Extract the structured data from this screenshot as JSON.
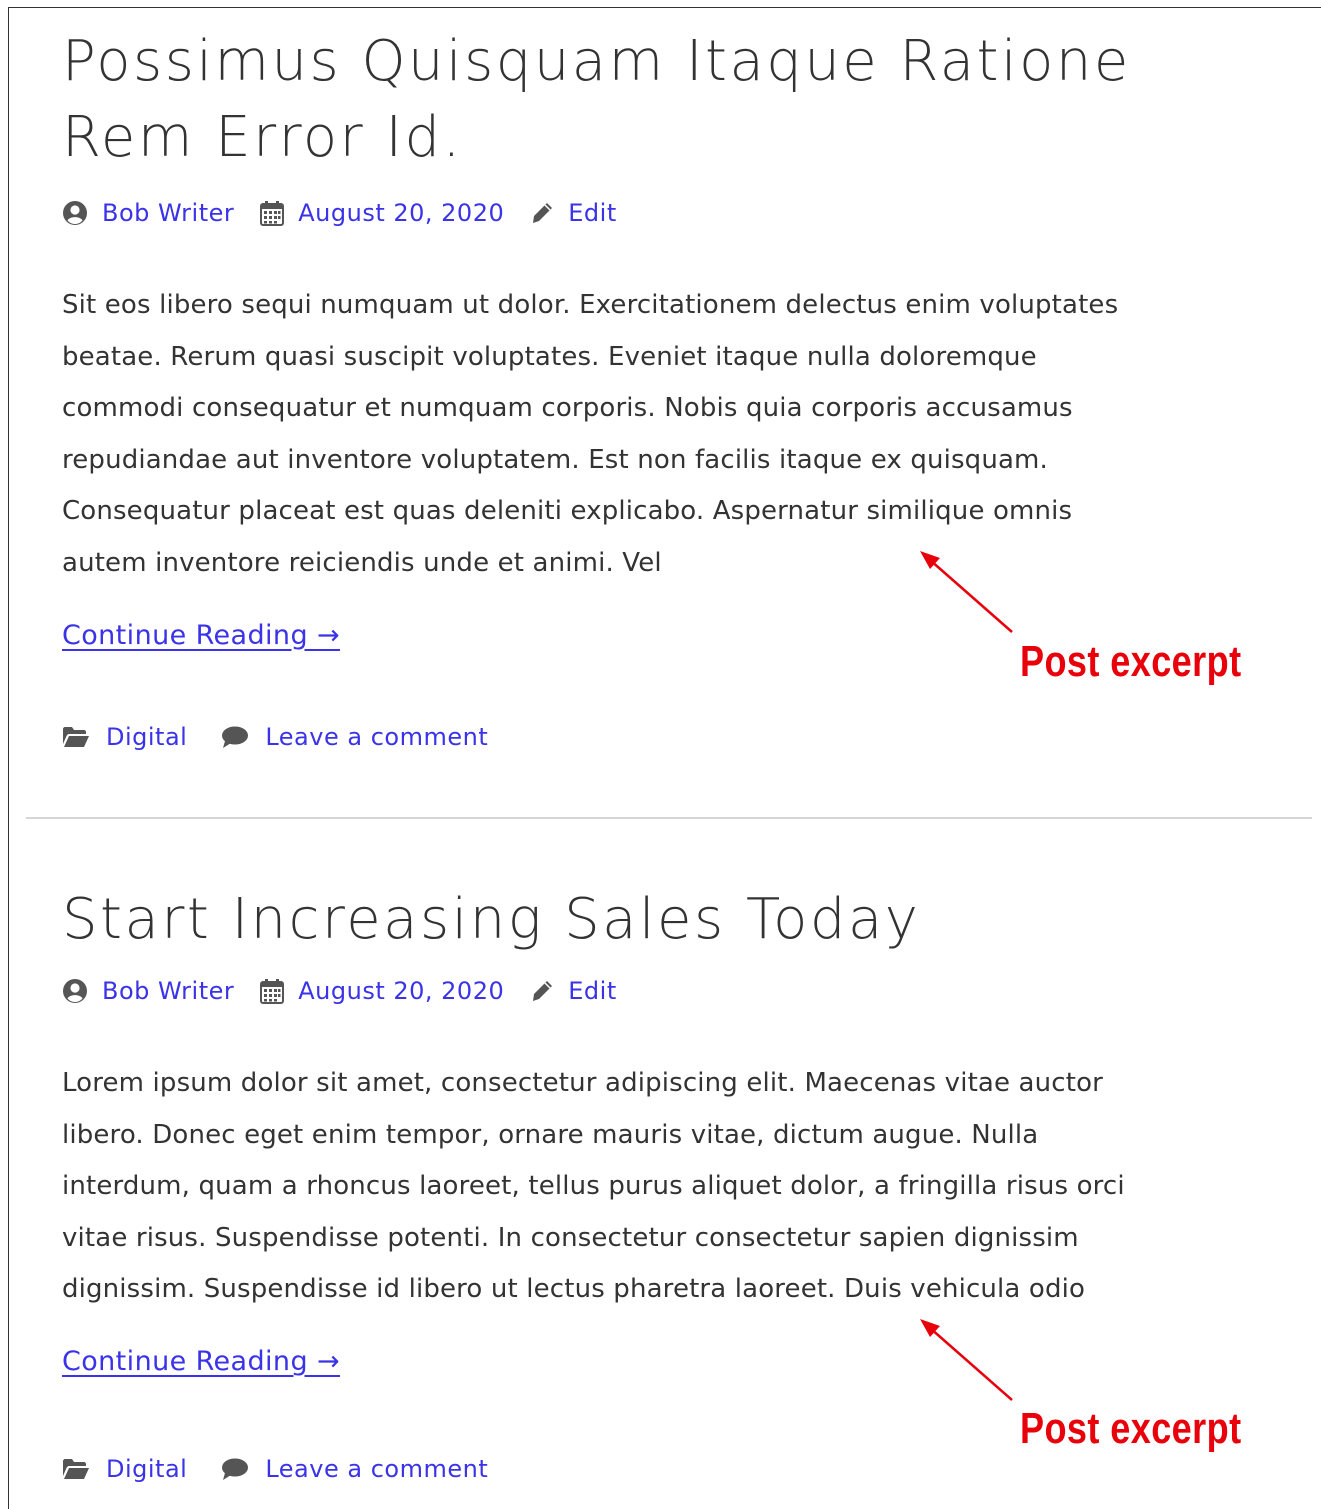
{
  "posts": [
    {
      "title_lines": [
        "Possimus Quisquam Itaque Ratione",
        "Rem Error Id."
      ],
      "author": "Bob Writer",
      "date": "August 20, 2020",
      "edit_label": "Edit",
      "excerpt_lines": [
        "Sit eos libero sequi numquam ut dolor. Exercitationem delectus enim voluptates",
        "beatae. Rerum quasi suscipit voluptates. Eveniet itaque nulla doloremque",
        "commodi consequatur et numquam corporis. Nobis quia corporis accusamus",
        "repudiandae aut inventore voluptatem. Est non facilis itaque ex quisquam.",
        "Consequatur placeat est quas deleniti explicabo. Aspernatur similique omnis",
        "autem inventore reiciendis unde et animi. Vel"
      ],
      "continue_label": "Continue Reading →",
      "category": "Digital",
      "comment_label": "Leave a comment"
    },
    {
      "title_lines": [
        "Start Increasing Sales Today"
      ],
      "author": "Bob Writer",
      "date": "August 20, 2020",
      "edit_label": "Edit",
      "excerpt_lines": [
        "Lorem ipsum dolor sit amet, consectetur adipiscing elit. Maecenas vitae auctor",
        "libero. Donec eget enim tempor, ornare mauris vitae, dictum augue. Nulla",
        "interdum, quam a rhoncus laoreet, tellus purus aliquet dolor, a fringilla risus orci",
        "vitae risus. Suspendisse potenti. In consectetur consectetur sapien dignissim",
        "dignissim. Suspendisse id libero ut lectus pharetra laoreet. Duis vehicula odio"
      ],
      "continue_label": "Continue Reading →",
      "category": "Digital",
      "comment_label": "Leave a comment"
    }
  ],
  "annotations": [
    "Post excerpt",
    "Post excerpt"
  ],
  "colors": {
    "link": "#3a33e8",
    "text": "#333333",
    "icon": "#555555",
    "annotation": "#e8000b",
    "separator": "#d6d6d6"
  },
  "icons": [
    "user-circle-icon",
    "calendar-icon",
    "pencil-icon",
    "folder-open-icon",
    "comment-icon"
  ]
}
